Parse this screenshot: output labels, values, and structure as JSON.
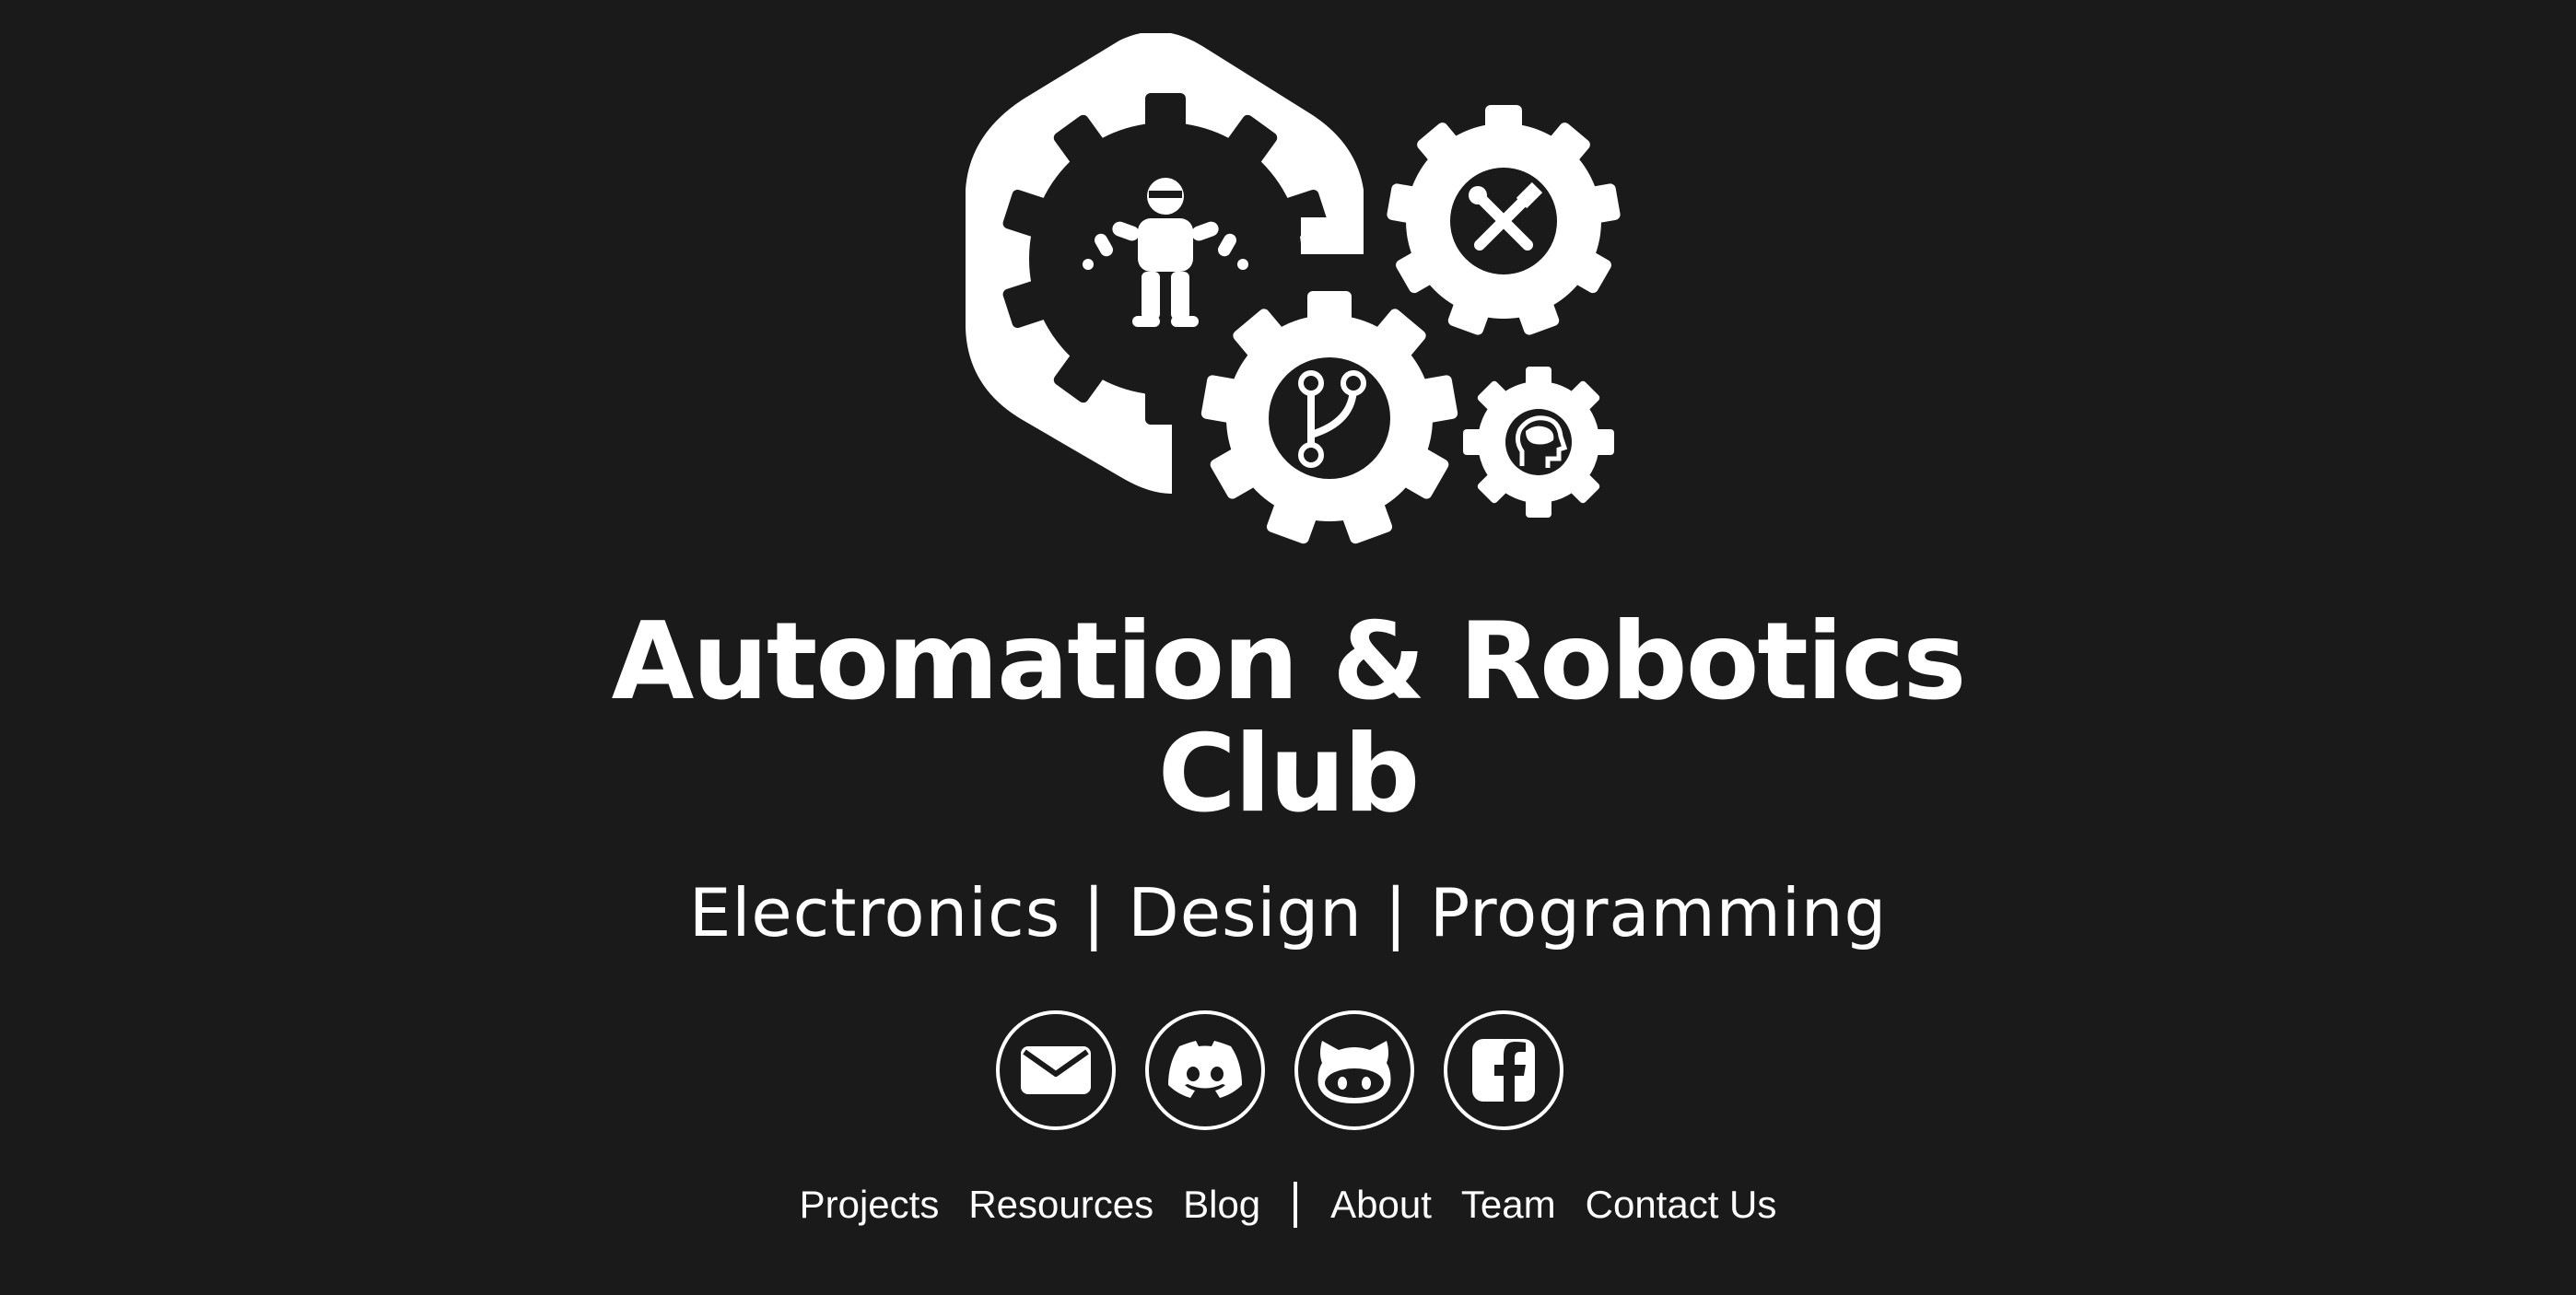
{
  "header": {
    "title_line1": "Automation & Robotics",
    "title_line2": "Club",
    "tagline": "Electronics | Design | Programming"
  },
  "logo": {
    "icons": [
      "hexagon-c-icon",
      "robot-gear-icon",
      "tools-gear-icon",
      "branch-gear-icon",
      "brain-gear-icon"
    ]
  },
  "socials": [
    {
      "name": "email",
      "icon": "envelope-icon"
    },
    {
      "name": "discord",
      "icon": "discord-icon"
    },
    {
      "name": "github",
      "icon": "github-icon"
    },
    {
      "name": "facebook",
      "icon": "facebook-icon"
    }
  ],
  "nav": {
    "left": [
      "Projects",
      "Resources",
      "Blog"
    ],
    "right": [
      "About",
      "Team",
      "Contact Us"
    ]
  },
  "colors": {
    "background": "#1a1a1a",
    "foreground": "#ffffff"
  }
}
